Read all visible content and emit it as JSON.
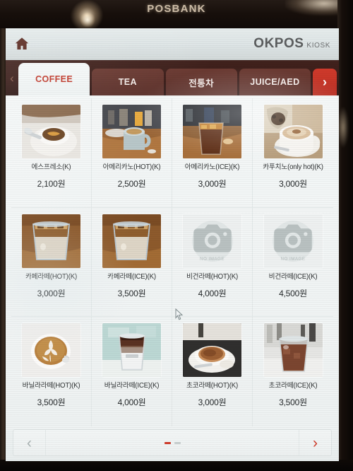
{
  "device": {
    "brand_label": "POSBANK"
  },
  "header": {
    "home_icon": "home-icon",
    "logo_main": "OKPOS",
    "logo_sub": "KIOSK"
  },
  "tabbar": {
    "prev_arrow": "‹",
    "next_arrow": "›",
    "tabs": [
      {
        "label": "COFFEE",
        "active": true
      },
      {
        "label": "TEA",
        "active": false
      },
      {
        "label": "전통차",
        "active": false
      },
      {
        "label": "JUICE/AED",
        "active": false
      }
    ]
  },
  "menu": {
    "currency_suffix": "원",
    "no_image_label": "NO IMAGE",
    "items": [
      {
        "name": "에스프레소(K)",
        "price": "2,100원",
        "image": "espresso-cup-saucer"
      },
      {
        "name": "아메리카노(HOT)(K)",
        "price": "2,500원",
        "image": "hot-americano-mug"
      },
      {
        "name": "아메리카노(ICE)(K)",
        "price": "3,000원",
        "image": "iced-americano-glass"
      },
      {
        "name": "카푸치노(only hot)(K)",
        "price": "3,000원",
        "image": "cappuccino-foam-cup"
      },
      {
        "name": "카페라떼(HOT)(K)",
        "price": "3,000원",
        "image": "iced-latte-glass"
      },
      {
        "name": "카페라떼(ICE)(K)",
        "price": "3,500원",
        "image": "iced-latte-glass"
      },
      {
        "name": "비건라떼(HOT)(K)",
        "price": "4,000원",
        "image": "no-image"
      },
      {
        "name": "비건라떼(ICE)(K)",
        "price": "4,500원",
        "image": "no-image"
      },
      {
        "name": "바닐라라떼(HOT)(K)",
        "price": "3,500원",
        "image": "latte-art-rosetta"
      },
      {
        "name": "바닐라라떼(ICE)(K)",
        "price": "4,000원",
        "image": "layered-iced-cup-mint"
      },
      {
        "name": "초코라떼(HOT)(K)",
        "price": "3,000원",
        "image": "hot-chocolate-saucer"
      },
      {
        "name": "초코라떼(ICE)(K)",
        "price": "3,500원",
        "image": "iced-chocolate-plastic-cup"
      }
    ]
  },
  "pager": {
    "prev_arrow": "‹",
    "next_arrow": "›",
    "page_count": 2,
    "current_page": 1
  },
  "colors": {
    "accent_red": "#cf3c2c",
    "tab_maroon": "#5b302a",
    "header_bg": "#dde4e5",
    "screen_bg": "#f2f4f4"
  }
}
